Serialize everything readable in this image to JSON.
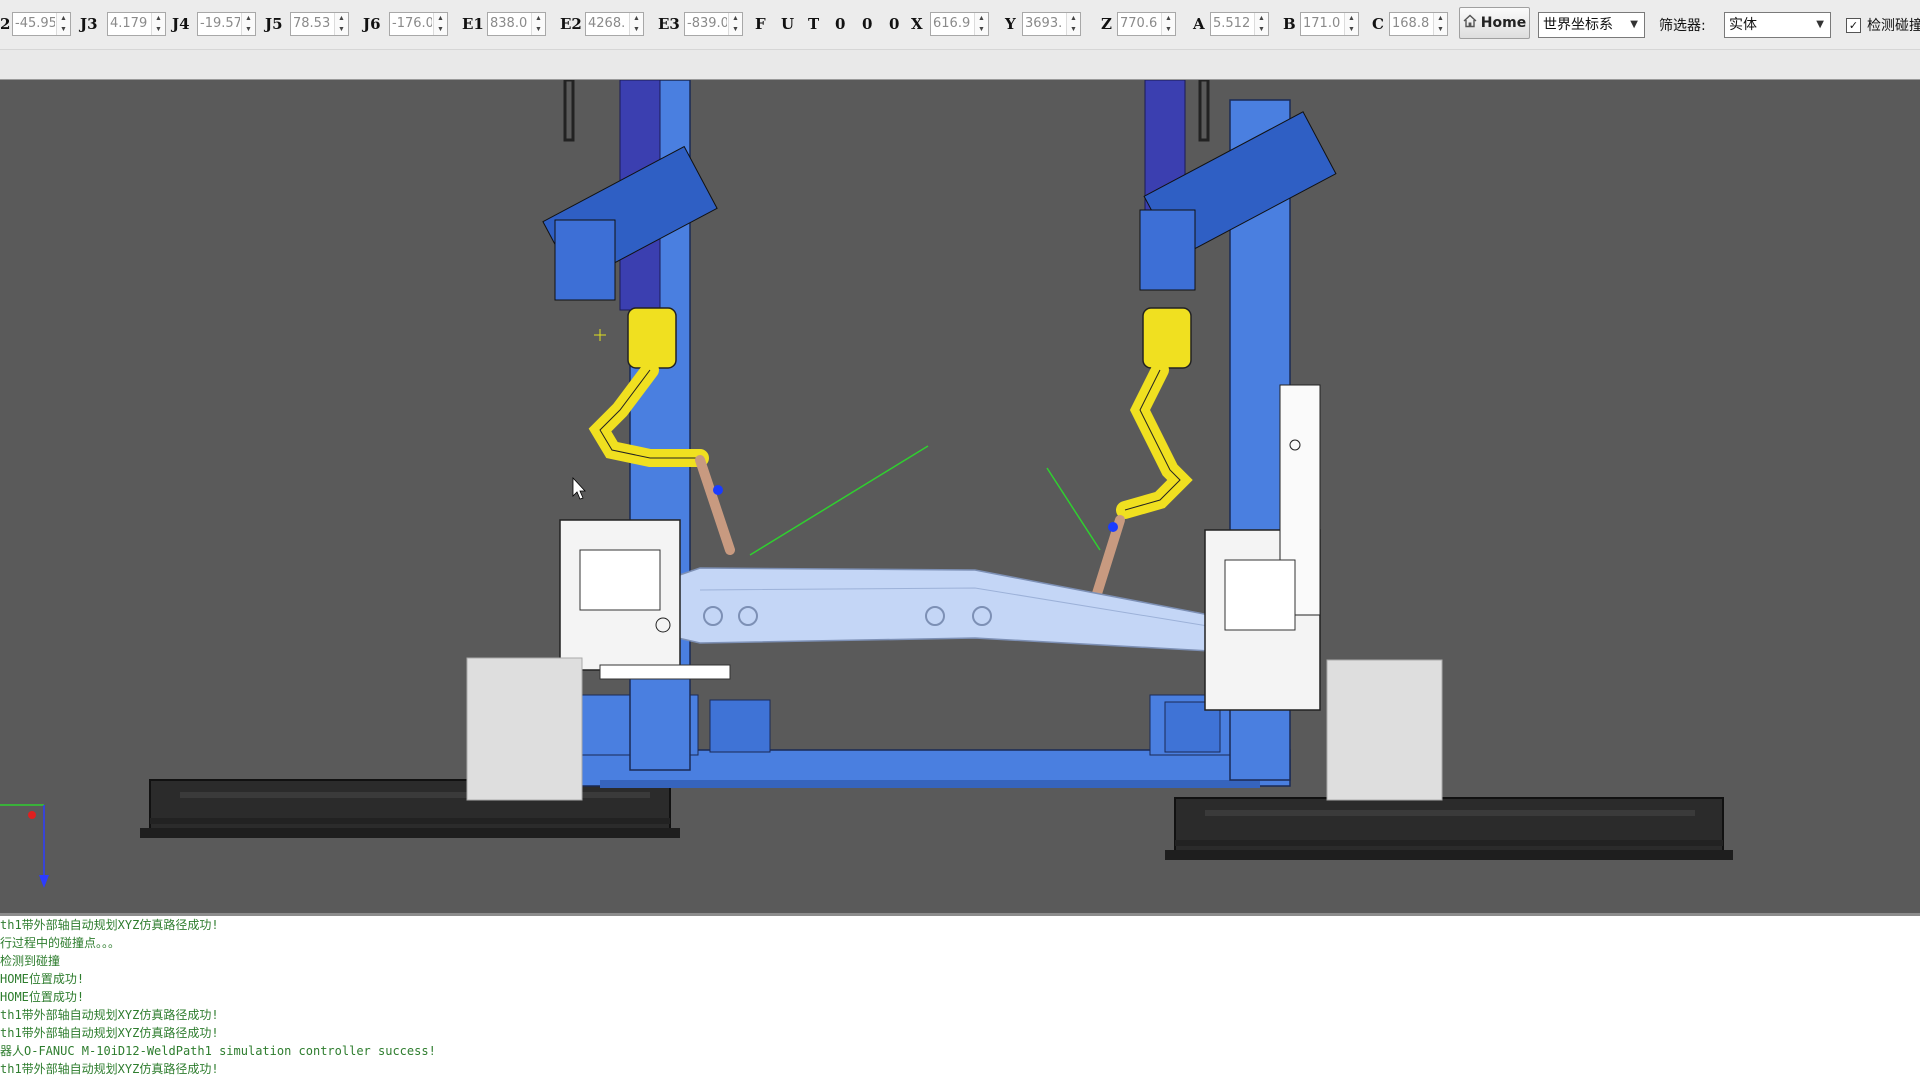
{
  "toolbar": {
    "fields": [
      {
        "label": "2",
        "value": "-45.95"
      },
      {
        "label": "J3",
        "value": "4.179"
      },
      {
        "label": "J4",
        "value": "-19.57"
      },
      {
        "label": "J5",
        "value": "78.53"
      },
      {
        "label": "J6",
        "value": "-176.0"
      },
      {
        "label": "E1",
        "value": "838.0"
      },
      {
        "label": "E2",
        "value": "4268."
      },
      {
        "label": "E3",
        "value": "-839.0"
      },
      {
        "label": "X",
        "value": "616.9"
      },
      {
        "label": "Y",
        "value": "3693."
      },
      {
        "label": "Z",
        "value": "770.6"
      },
      {
        "label": "A",
        "value": "5.512"
      },
      {
        "label": "B",
        "value": "171.0"
      },
      {
        "label": "C",
        "value": "168.8"
      }
    ],
    "config_letters": [
      "F",
      "U",
      "T",
      "0",
      "0",
      "0"
    ],
    "home_label": "Home",
    "coord_system": "世界坐标系",
    "filter_label": "筛选器:",
    "filter_value": "实体",
    "collision_label": "检测碰撞",
    "collision_checked": true
  },
  "viewport": {
    "background": "#5a5a5a",
    "robot_color": "#f0e020",
    "gantry_color": "#4a7fe0",
    "fixture_color": "#ffffff",
    "part_color": "#c4d6f6",
    "rail_color": "#2b2b2b"
  },
  "log": {
    "lines": [
      "th1带外部轴自动规划XYZ仿真路径成功!",
      "行过程中的碰撞点。。。",
      "检测到碰撞",
      "HOME位置成功!",
      "HOME位置成功!",
      "th1带外部轴自动规划XYZ仿真路径成功!",
      "th1带外部轴自动规划XYZ仿真路径成功!",
      "器人O-FANUC M-10iD12-WeldPath1 simulation controller success!",
      "th1带外部轴自动规划XYZ仿真路径成功!"
    ]
  }
}
